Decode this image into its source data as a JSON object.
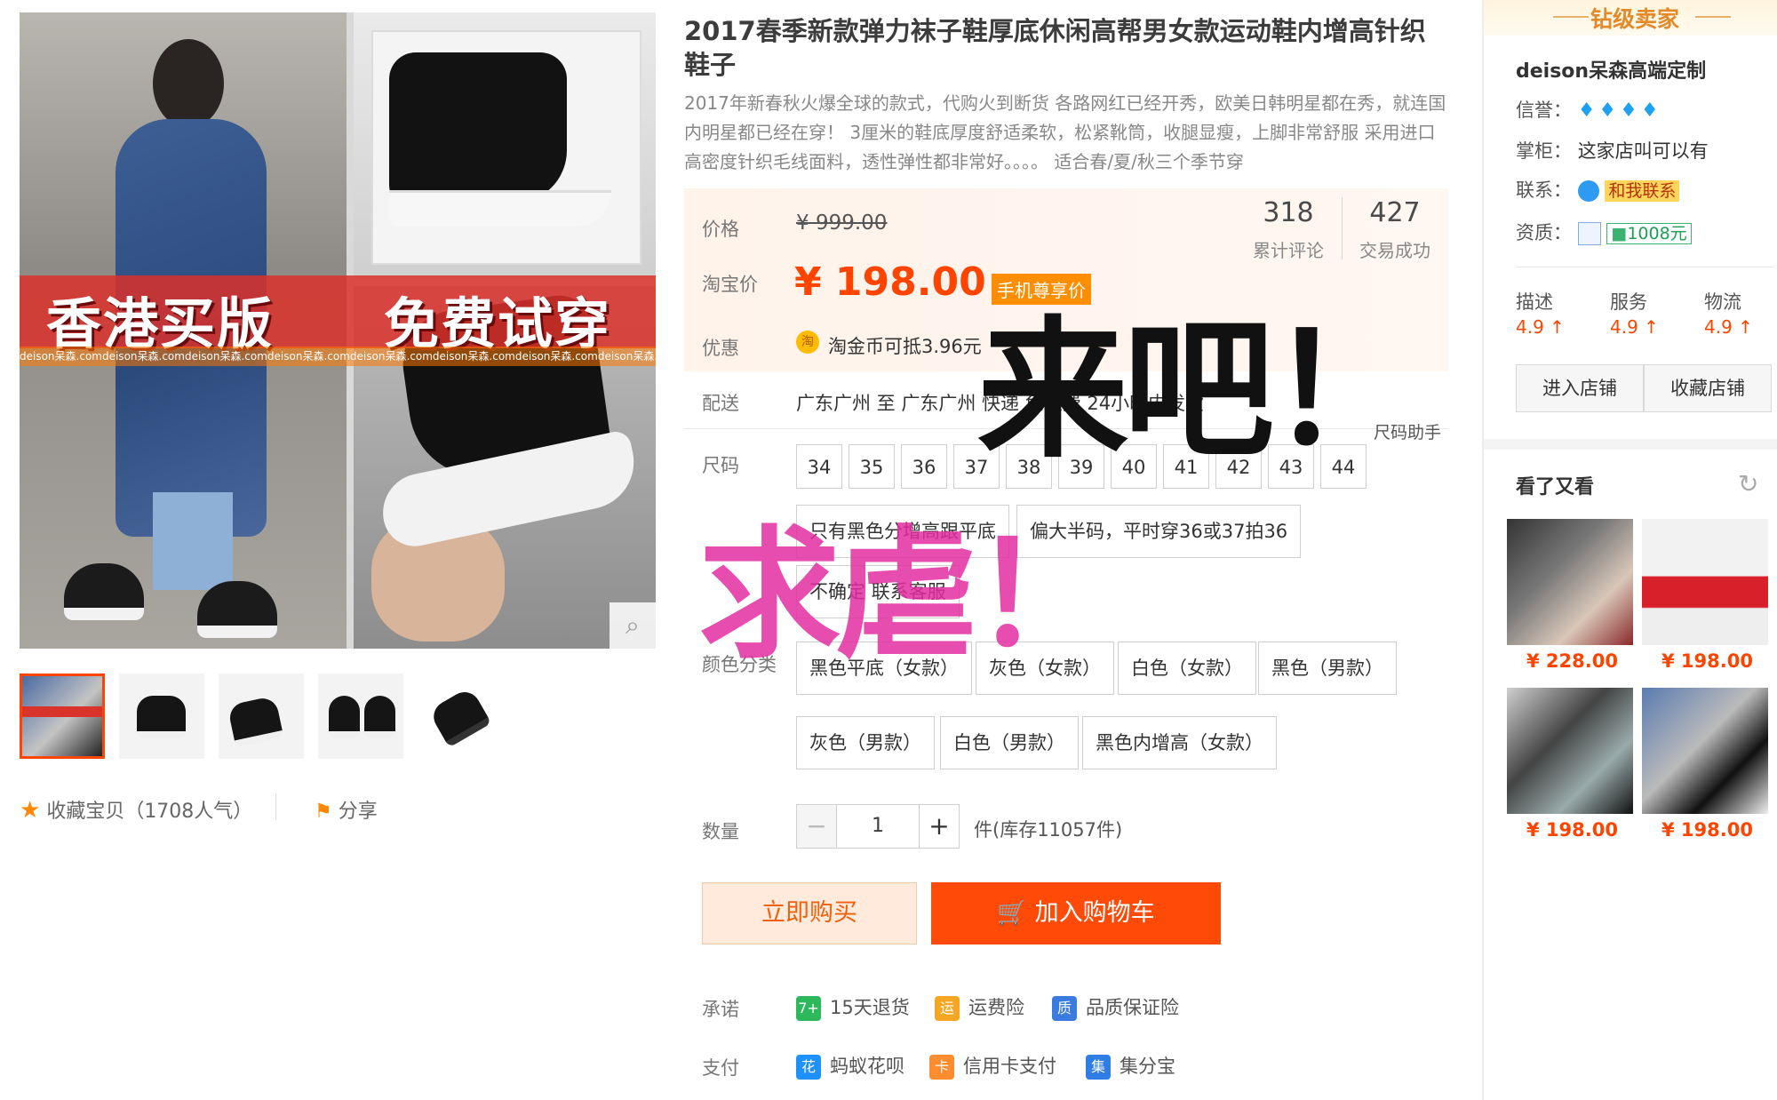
{
  "gallery": {
    "banner_left": "香港买版",
    "banner_right": "免费试穿",
    "watermark": "deison呆森.comdeison呆森.comdeison呆森.comdeison呆森.comdeison呆森.comdeison呆森.comdeison呆森.comdeison呆森.com",
    "favorite_label": "收藏宝贝（1708人气）",
    "share_label": "分享"
  },
  "product": {
    "title": "2017春季新款弹力袜子鞋厚底休闲高帮男女款运动鞋内增高针织鞋子",
    "subtitle": "2017年新春秋火爆全球的款式，代购火到断货 各路网红已经开秀，欧美日韩明星都在秀，就连国内明星都已经在穿！ 3厘米的鞋底厚度舒适柔软，松紧靴筒，收腿显瘦，上脚非常舒服 采用进口高密度针织毛线面料，透性弹性都非常好。。。。 适合春/夏/秋三个季节穿"
  },
  "price": {
    "price_label": "价格",
    "original": "¥ 999.00",
    "taobao_label": "淘宝价",
    "current": "¥ 198.00",
    "mobile_badge": "手机尊享价",
    "discount_label": "优惠",
    "coin_icon_text": "淘",
    "discount_text": "淘金币可抵3.96元",
    "reviews_count": "318",
    "reviews_label": "累计评论",
    "deals_count": "427",
    "deals_label": "交易成功"
  },
  "delivery": {
    "label": "配送",
    "text": "广东广州 至  广东广州  快递 免运费 24小时内发货"
  },
  "sizes": {
    "label": "尺码",
    "helper": "尺码助手",
    "options": [
      "34",
      "35",
      "36",
      "37",
      "38",
      "39",
      "40",
      "41",
      "42",
      "43",
      "44"
    ]
  },
  "notes": {
    "note1": "只有黑色分增高跟平底",
    "note2": "偏大半码，平时穿36或37拍36",
    "note3": "不确定 联系客服"
  },
  "colors": {
    "label": "颜色分类",
    "options": [
      "黑色平底（女款）",
      "灰色（女款）",
      "白色（女款）",
      "黑色（男款）",
      "灰色（男款）",
      "白色（男款）",
      "黑色内增高（女款）"
    ]
  },
  "quantity": {
    "label": "数量",
    "minus": "−",
    "value": "1",
    "plus": "+",
    "stock": "件(库存11057件)"
  },
  "buttons": {
    "buy_now": "立即购买",
    "add_cart": "加入购物车",
    "cart_icon": "🛒"
  },
  "promise": {
    "label": "承诺",
    "items": [
      {
        "icon": "7+",
        "text": "15天退货",
        "color": "#2db85c"
      },
      {
        "icon": "运",
        "text": "运费险",
        "color": "#f5a623"
      },
      {
        "icon": "质",
        "text": "品质保证险",
        "color": "#3b7be0"
      }
    ]
  },
  "payment": {
    "label": "支付",
    "items": [
      {
        "icon": "花",
        "text": "蚂蚁花呗",
        "color": "#1e90ff"
      },
      {
        "icon": "卡",
        "text": "信用卡支付",
        "color": "#ff8c2e"
      },
      {
        "icon": "集",
        "text": "集分宝",
        "color": "#2e7ee6"
      }
    ]
  },
  "overlay": {
    "black_text": "来吧！",
    "pink_text": "求虐！"
  },
  "shop": {
    "seller_level": "钻级卖家",
    "name": "deison呆森高端定制",
    "credit_label": "信誉：",
    "credit_icons": "♦♦♦♦",
    "keeper_label": "掌柜：",
    "keeper_value": "这家店叫可以有",
    "contact_label": "联系：",
    "contact_link": "和我联系",
    "qualification_label": "资质：",
    "deposit": "1008元",
    "ratings": [
      {
        "label": "描述",
        "score": "4.9"
      },
      {
        "label": "服务",
        "score": "4.9"
      },
      {
        "label": "物流",
        "score": "4.9"
      }
    ],
    "enter_shop": "进入店铺",
    "collect_shop": "收藏店铺"
  },
  "recommend": {
    "title": "看了又看",
    "refresh_icon": "↻",
    "items": [
      {
        "price": "¥ 228.00"
      },
      {
        "price": "¥ 198.00"
      },
      {
        "price": "¥ 198.00"
      },
      {
        "price": "¥ 198.00"
      }
    ]
  },
  "colors_theme": {
    "accent": "#ff4400",
    "orange": "#ff8d00",
    "overlay_pink": "#e22ea0"
  }
}
